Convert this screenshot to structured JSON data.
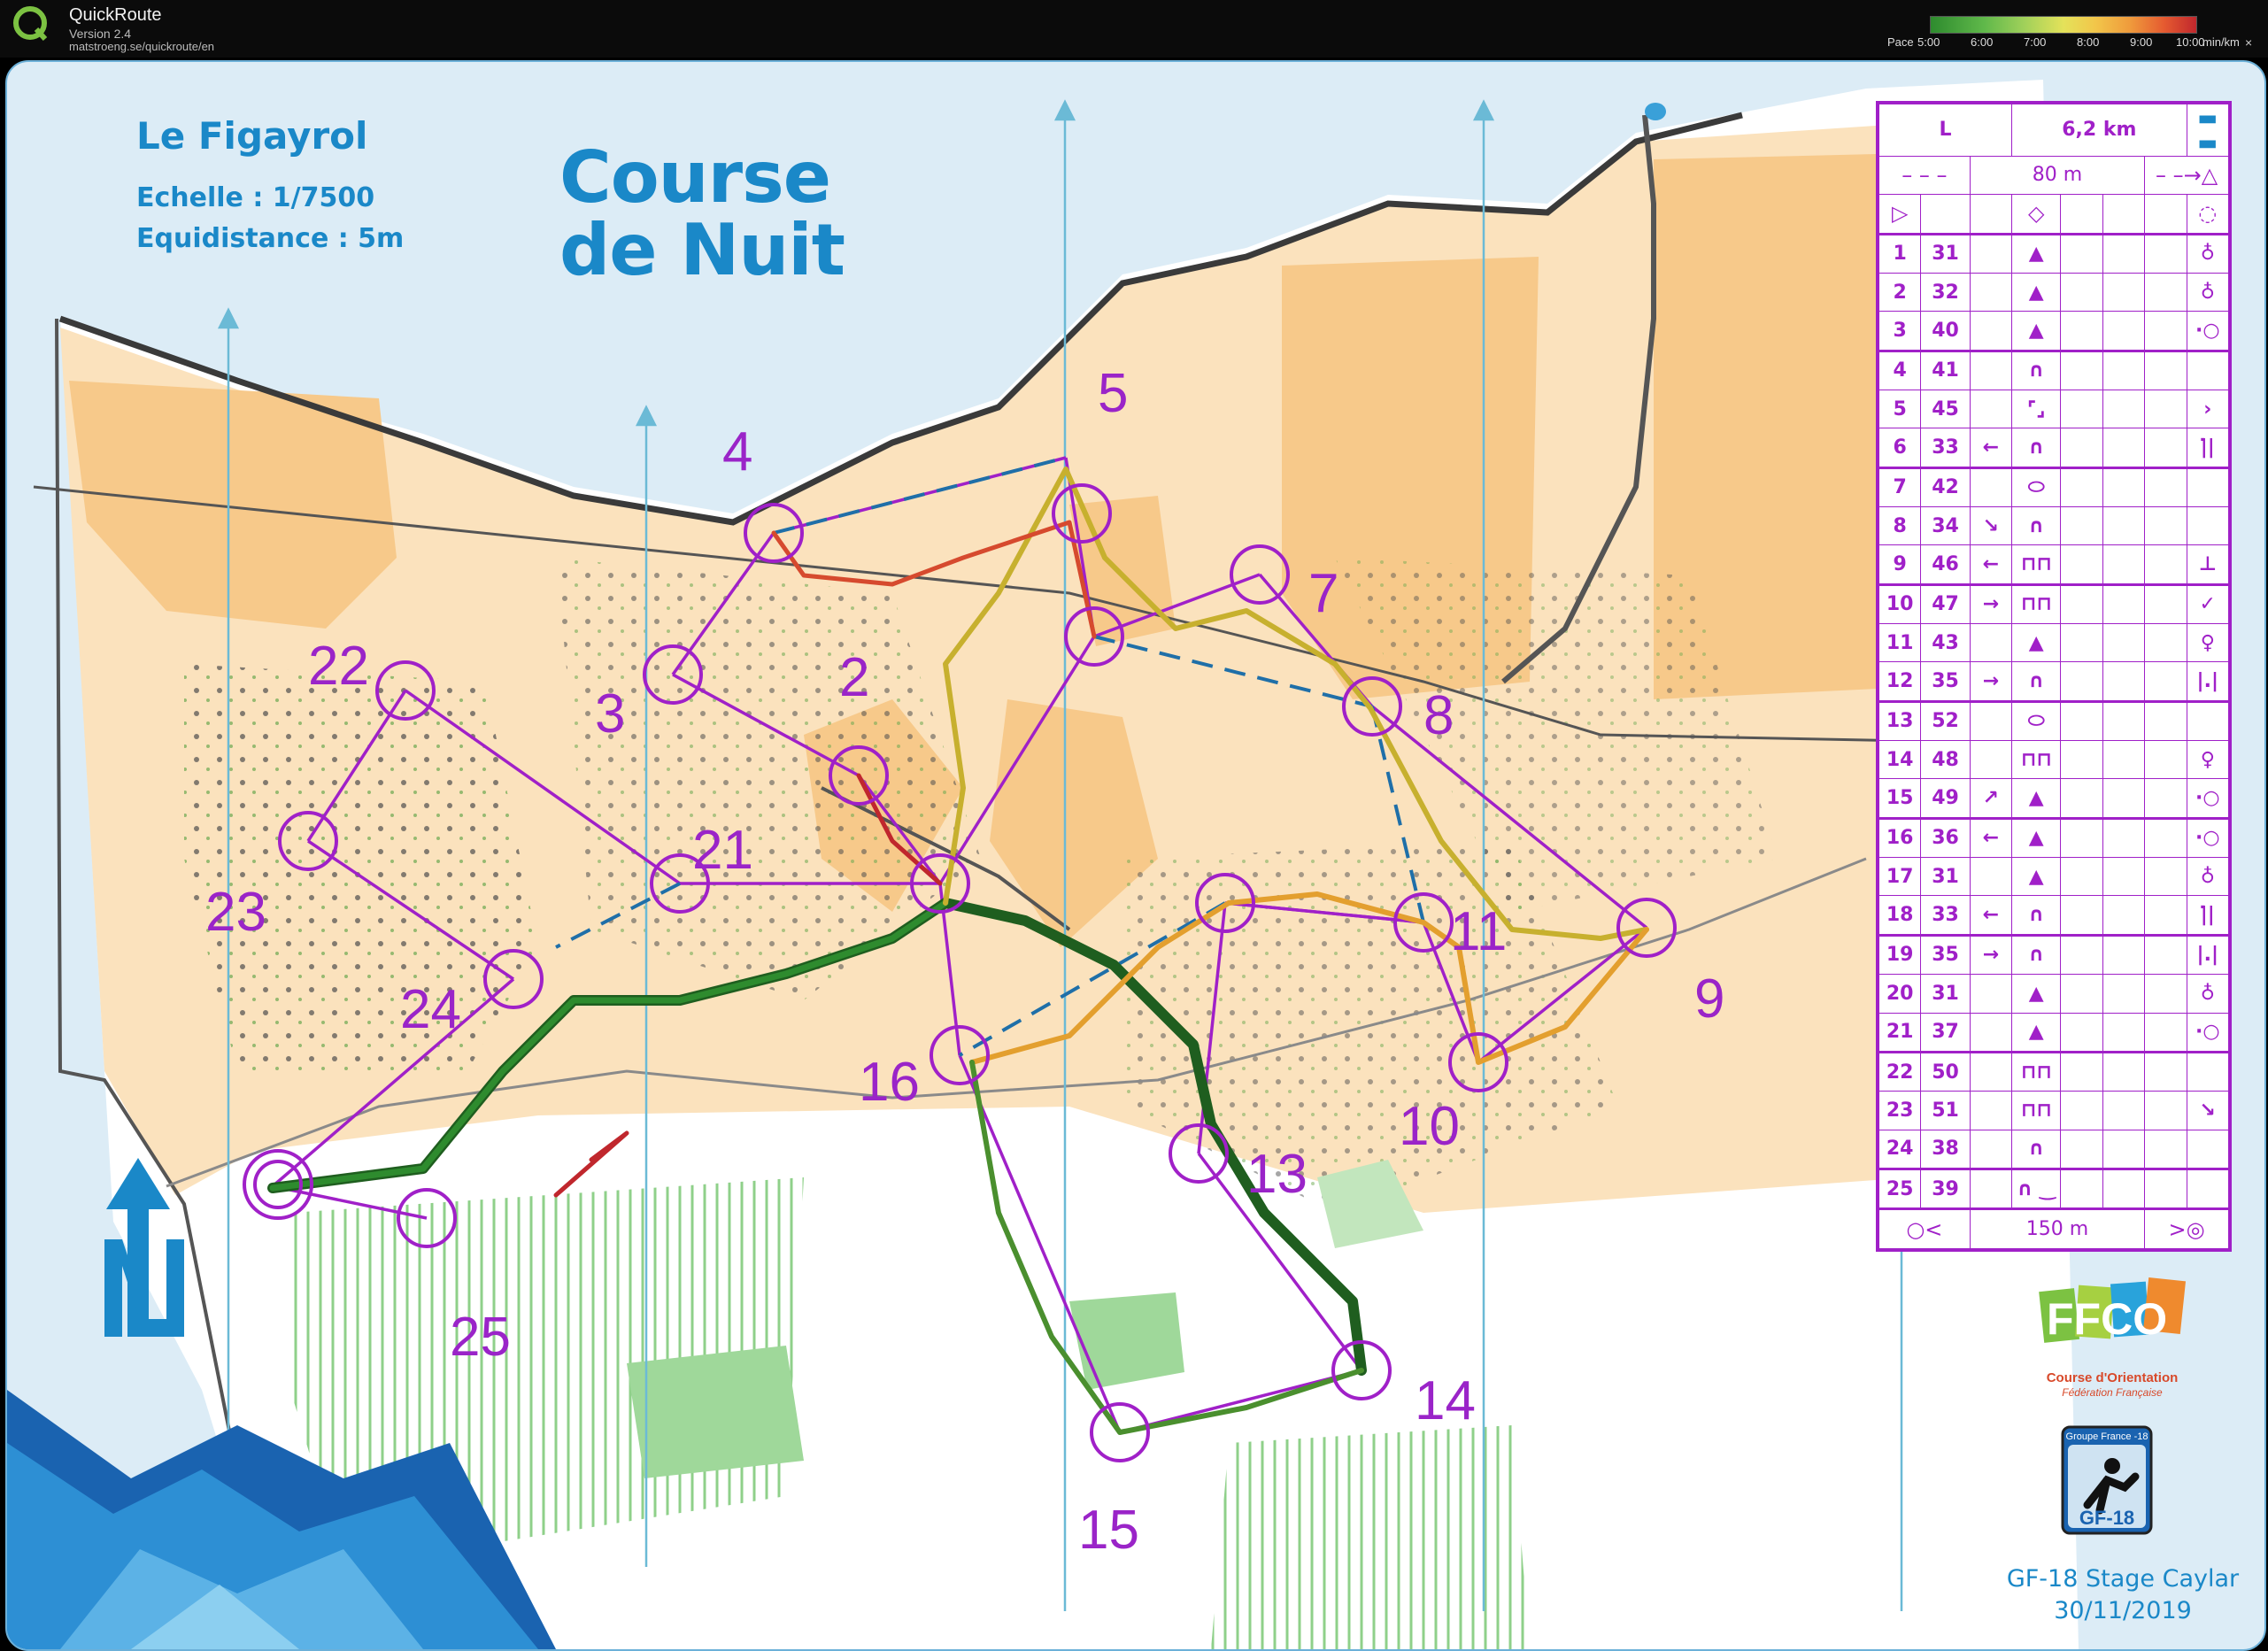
{
  "app": {
    "title": "QuickRoute",
    "version": "Version 2.4",
    "url": "matstroeng.se/quickroute/en"
  },
  "pace_legend": {
    "label": "Pace",
    "ticks": [
      "5:00",
      "6:00",
      "7:00",
      "8:00",
      "9:00",
      "10:00"
    ],
    "unit": "min/km",
    "colors": [
      "#2e8b2e",
      "#9fd05a",
      "#e4e25a",
      "#ef9b3c",
      "#c0272d"
    ]
  },
  "map": {
    "name": "Le Figayrol",
    "scale": "Echelle : 1/7500",
    "contour": "Equidistance : 5m",
    "event_title_line1": "Course",
    "event_title_line2": "de Nuit",
    "colors": {
      "open_land": "#f7c98a",
      "rough_open": "#fbe2bd",
      "forest": "#ffffff",
      "vegetation": "#9fd89a",
      "course": "#a020c8",
      "title": "#1a88c8"
    },
    "controls": [
      {
        "num": "2"
      },
      {
        "num": "3"
      },
      {
        "num": "4"
      },
      {
        "num": "5"
      },
      {
        "num": "7"
      },
      {
        "num": "8"
      },
      {
        "num": "9"
      },
      {
        "num": "10"
      },
      {
        "num": "11"
      },
      {
        "num": "13"
      },
      {
        "num": "14"
      },
      {
        "num": "15"
      },
      {
        "num": "16"
      },
      {
        "num": "21"
      },
      {
        "num": "22"
      },
      {
        "num": "23"
      },
      {
        "num": "24"
      },
      {
        "num": "25"
      }
    ]
  },
  "description_sheet": {
    "class": "L",
    "length": "6,2 km",
    "start_distance": "80 m",
    "finish_distance": "150 m",
    "rows": [
      {
        "num": "1",
        "code": "31",
        "dir": "",
        "feature": "▲",
        "detail": "♁"
      },
      {
        "num": "2",
        "code": "32",
        "dir": "",
        "feature": "▲",
        "detail": "♁"
      },
      {
        "num": "3",
        "code": "40",
        "dir": "",
        "feature": "▲",
        "detail": "·○"
      },
      {
        "num": "4",
        "code": "41",
        "dir": "",
        "feature": "∩",
        "detail": ""
      },
      {
        "num": "5",
        "code": "45",
        "dir": "",
        "feature": "⌜⌟",
        "detail": "›"
      },
      {
        "num": "6",
        "code": "33",
        "dir": "←",
        "feature": "∩",
        "detail": "|̇|"
      },
      {
        "num": "7",
        "code": "42",
        "dir": "",
        "feature": "⬭",
        "detail": ""
      },
      {
        "num": "8",
        "code": "34",
        "dir": "↘",
        "feature": "∩",
        "detail": ""
      },
      {
        "num": "9",
        "code": "46",
        "dir": "←",
        "feature": "⊓⊓",
        "detail": "⊥"
      },
      {
        "num": "10",
        "code": "47",
        "dir": "→",
        "feature": "⊓⊓",
        "detail": "✓"
      },
      {
        "num": "11",
        "code": "43",
        "dir": "",
        "feature": "▲",
        "detail": "♀"
      },
      {
        "num": "12",
        "code": "35",
        "dir": "→",
        "feature": "∩",
        "detail": "|.|"
      },
      {
        "num": "13",
        "code": "52",
        "dir": "",
        "feature": "⬭",
        "detail": ""
      },
      {
        "num": "14",
        "code": "48",
        "dir": "",
        "feature": "⊓⊓",
        "detail": "♀"
      },
      {
        "num": "15",
        "code": "49",
        "dir": "↗",
        "feature": "▲",
        "detail": "·○"
      },
      {
        "num": "16",
        "code": "36",
        "dir": "←",
        "feature": "▲",
        "detail": "·○"
      },
      {
        "num": "17",
        "code": "31",
        "dir": "",
        "feature": "▲",
        "detail": "♁"
      },
      {
        "num": "18",
        "code": "33",
        "dir": "←",
        "feature": "∩",
        "detail": "|̇|"
      },
      {
        "num": "19",
        "code": "35",
        "dir": "→",
        "feature": "∩",
        "detail": "|.|"
      },
      {
        "num": "20",
        "code": "31",
        "dir": "",
        "feature": "▲",
        "detail": "♁"
      },
      {
        "num": "21",
        "code": "37",
        "dir": "",
        "feature": "▲",
        "detail": "·○"
      },
      {
        "num": "22",
        "code": "50",
        "dir": "",
        "feature": "⊓⊓",
        "detail": ""
      },
      {
        "num": "23",
        "code": "51",
        "dir": "",
        "feature": "⊓⊓",
        "detail": "↘"
      },
      {
        "num": "24",
        "code": "38",
        "dir": "",
        "feature": "∩",
        "detail": ""
      },
      {
        "num": "25",
        "code": "39",
        "dir": "",
        "feature": "∩ ‿",
        "detail": ""
      }
    ]
  },
  "logos": {
    "ffco_letters": "FFCO",
    "ffco_line1": "Course d'Orientation",
    "ffco_line2": "Fédération Française",
    "gf18_top": "Groupe France -18",
    "gf18_badge": "GF-18"
  },
  "footer": {
    "line1": "GF-18 Stage Caylar",
    "line2": "30/11/2019"
  }
}
